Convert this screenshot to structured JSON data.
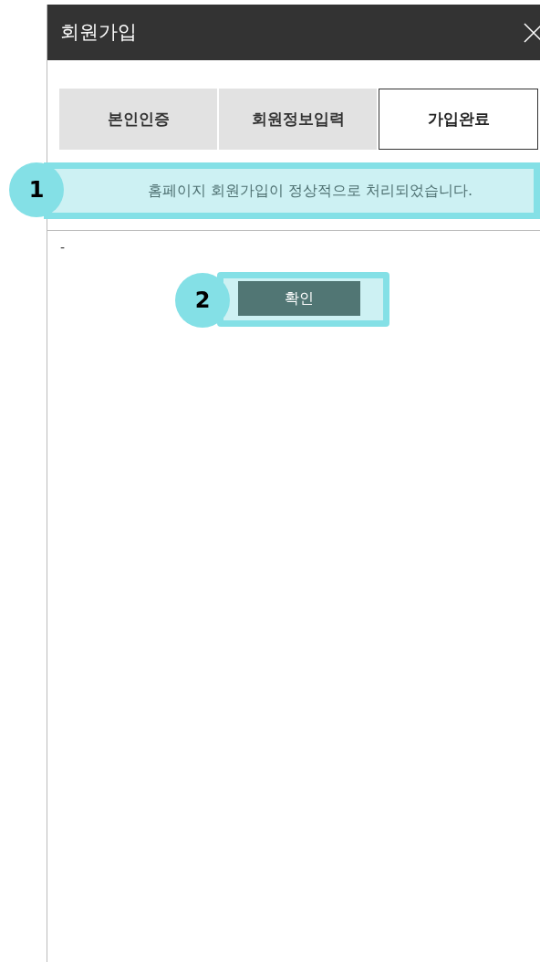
{
  "window": {
    "title": "회원가입"
  },
  "steps": [
    {
      "label": "본인인증",
      "selected": false
    },
    {
      "label": "회원정보입력",
      "selected": false
    },
    {
      "label": "가입완료",
      "selected": true
    }
  ],
  "message": {
    "badge": "1",
    "text": "홈페이지 회원가입이 정상적으로 처리되었습니다."
  },
  "note": "-",
  "confirm": {
    "badge": "2",
    "label": "확인"
  }
}
